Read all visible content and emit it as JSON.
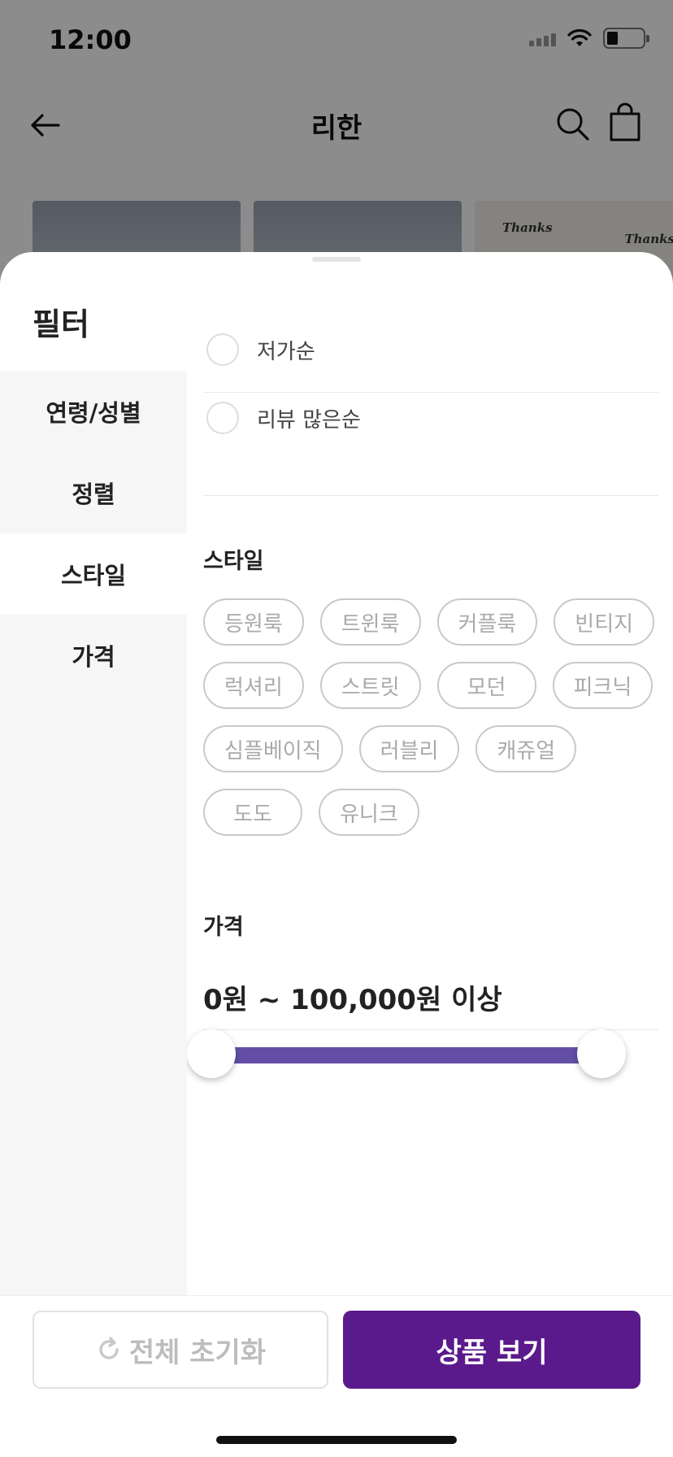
{
  "status_bar": {
    "time": "12:00",
    "battery_level": 0.3
  },
  "top_nav": {
    "title": "리한",
    "back_icon": "arrow-left-icon",
    "search_icon": "search-icon",
    "cart_icon": "shopping-bag-icon"
  },
  "thumbnails": [
    {
      "kind": "photo"
    },
    {
      "kind": "photo"
    },
    {
      "kind": "card",
      "text_left": "Thanks",
      "text_right": "Thanks"
    }
  ],
  "sheet": {
    "title": "필터",
    "side_menu": [
      {
        "label": "연령/성별",
        "active": false
      },
      {
        "label": "정렬",
        "active": false
      },
      {
        "label": "스타일",
        "active": true
      },
      {
        "label": "가격",
        "active": false
      }
    ],
    "sort_options": [
      {
        "label": "저가순",
        "selected": false
      },
      {
        "label": "리뷰 많은순",
        "selected": false
      }
    ],
    "style": {
      "title": "스타일",
      "chips": [
        "등원룩",
        "트윈룩",
        "커플룩",
        "빈티지",
        "럭셔리",
        "스트릿",
        "모던",
        "피크닉",
        "심플베이직",
        "러블리",
        "캐쥬얼",
        "도도",
        "유니크"
      ]
    },
    "price": {
      "title": "가격",
      "range_text": "0원 ~ 100,000원 이상",
      "min": 0,
      "max": 100000,
      "selected_min": 0,
      "selected_max": 100000
    }
  },
  "actions": {
    "reset_label": "전체 초기화",
    "reset_icon": "refresh-icon",
    "view_label": "상품 보기"
  },
  "colors": {
    "accent": "#5b1a8c",
    "slider": "#6350a6"
  }
}
